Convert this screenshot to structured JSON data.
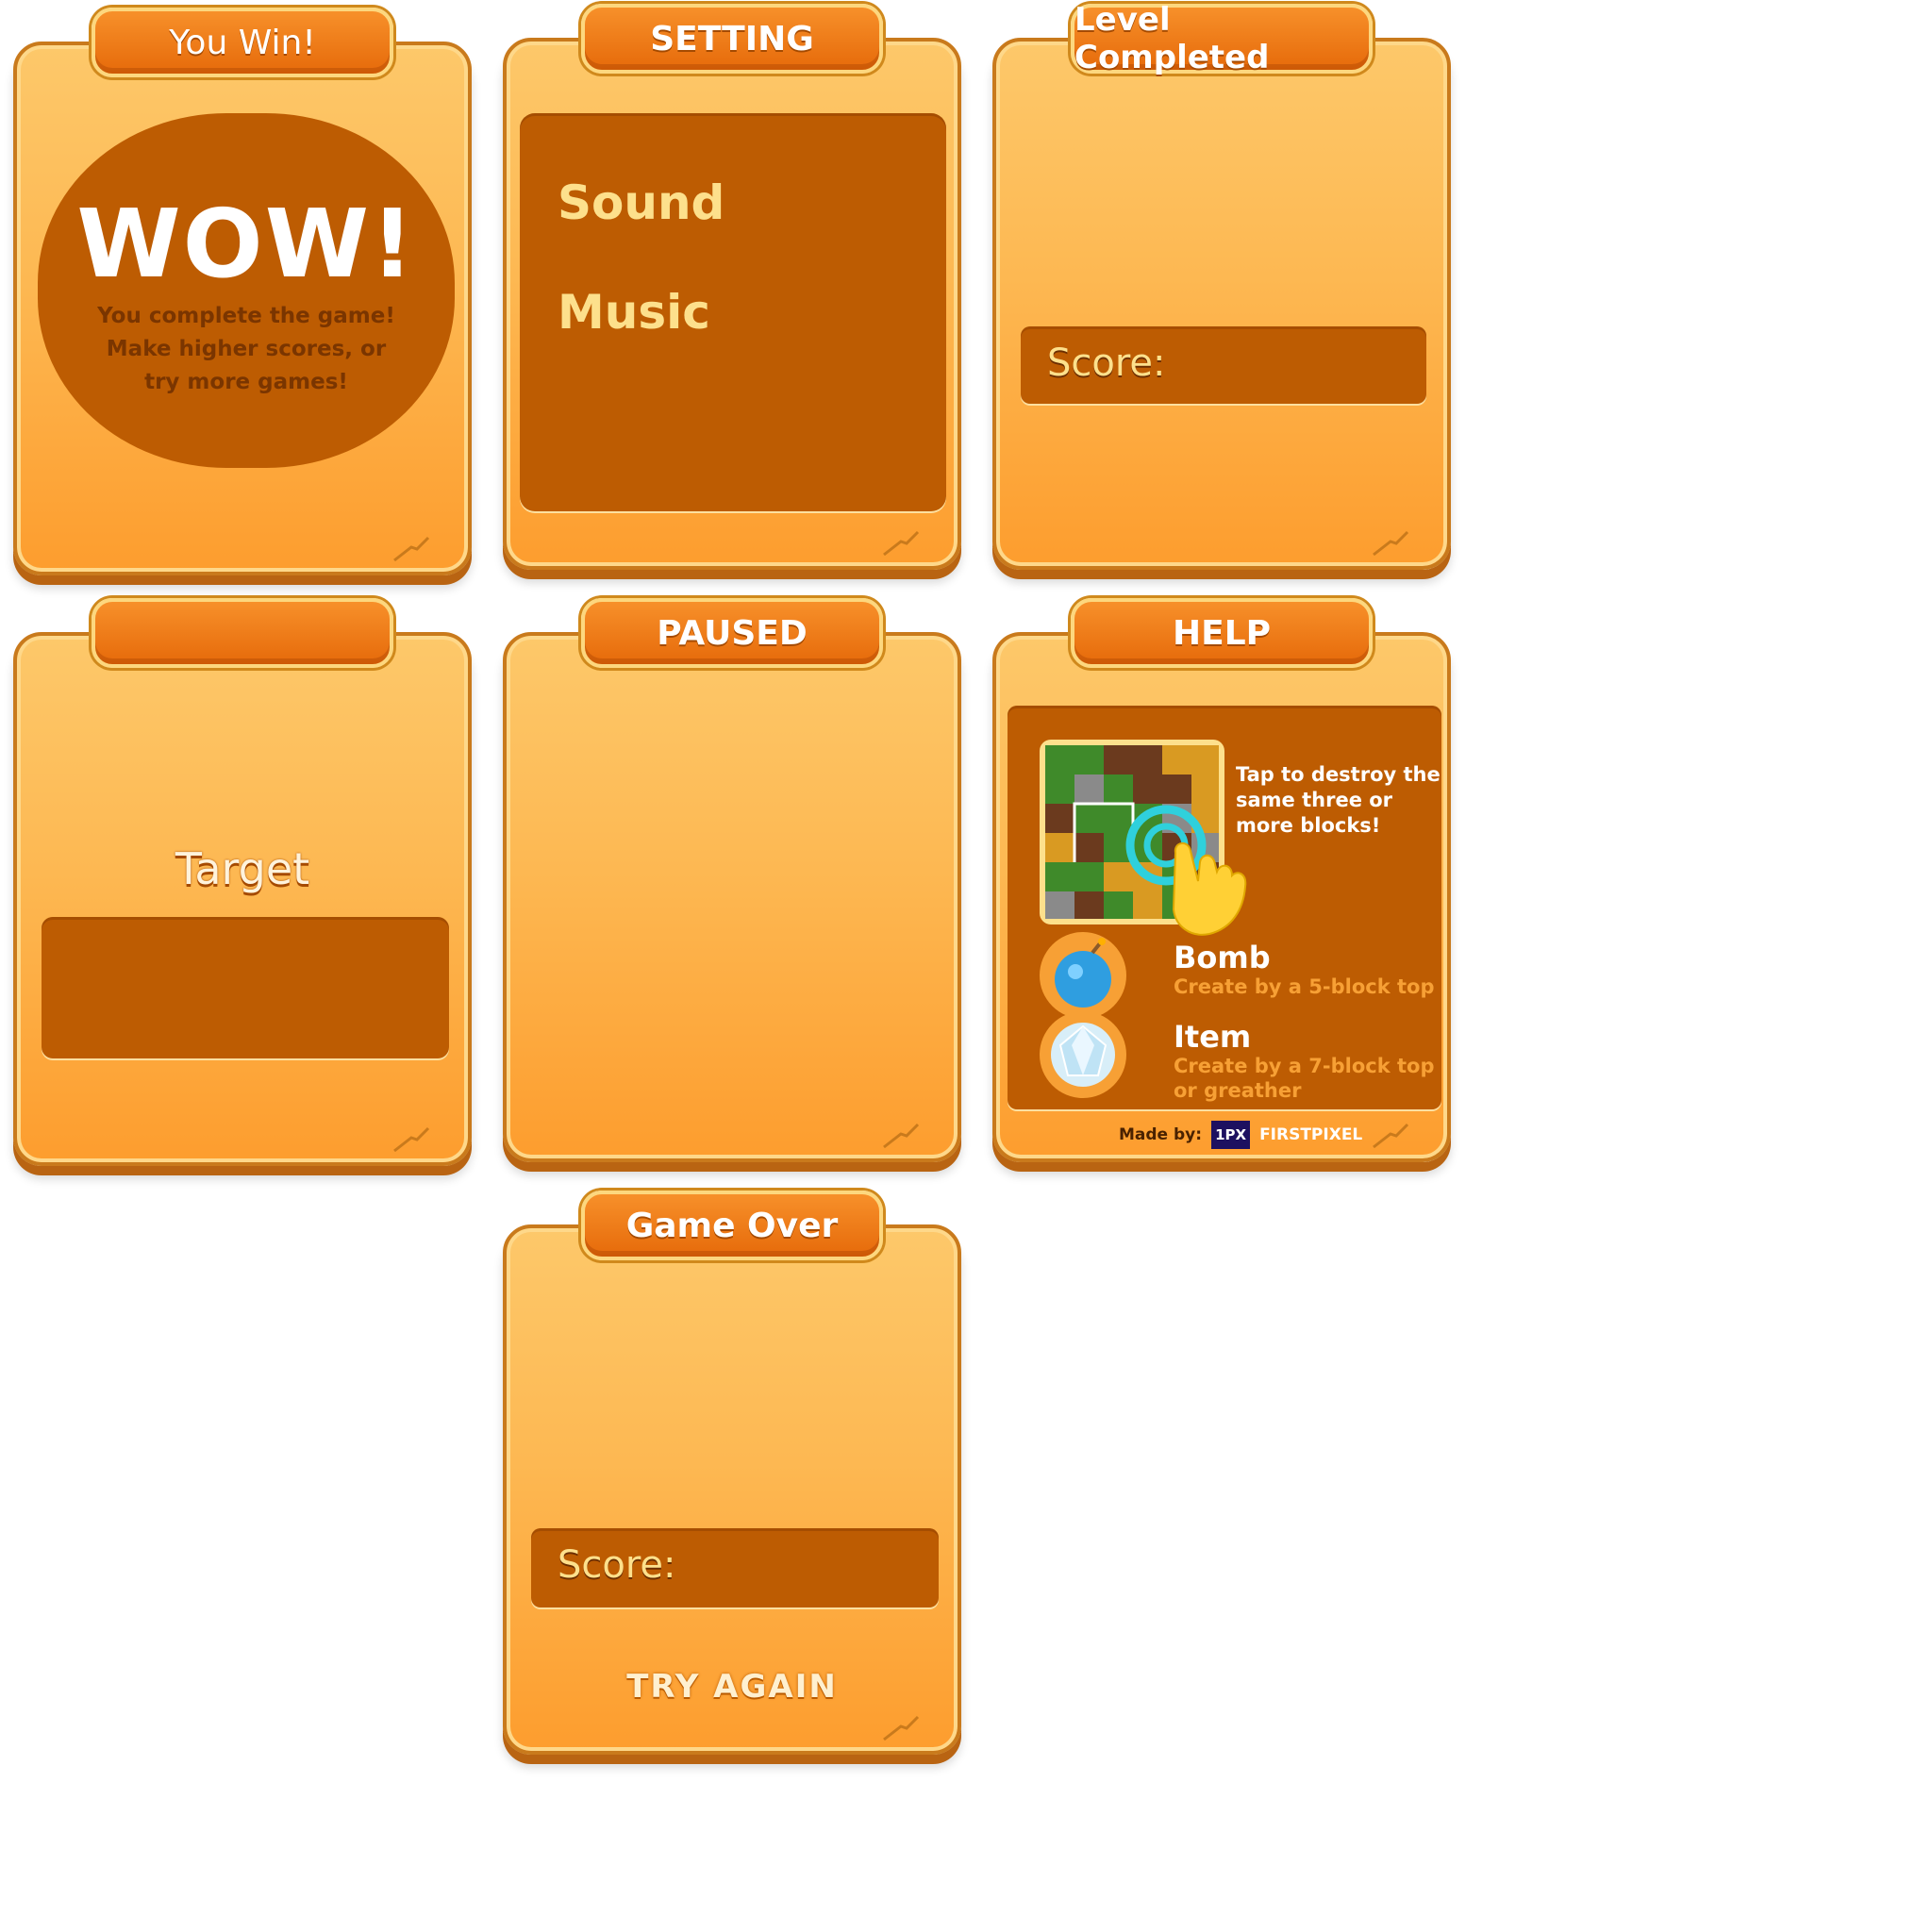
{
  "cards": {
    "you_win": {
      "title": "You Win!",
      "headline": "WOW!",
      "message_line1": "You complete the game!",
      "message_line2": "Make higher scores, or",
      "message_line3": "try more games!"
    },
    "setting": {
      "title": "SETTING",
      "sound_label": "Sound",
      "music_label": "Music"
    },
    "level_completed": {
      "title": "Level Completed",
      "score_label": "Score:"
    },
    "target": {
      "title": "",
      "target_label": "Target"
    },
    "paused": {
      "title": "PAUSED"
    },
    "help": {
      "title": "HELP",
      "tap_line1": "Tap to destroy the",
      "tap_line2": "same three or",
      "tap_line3": "more blocks!",
      "bomb_title": "Bomb",
      "bomb_desc": "Create by a 5-block top",
      "item_title": "Item",
      "item_desc_line1": "Create by a 7-block top",
      "item_desc_line2": "or greather",
      "made_by": "Made by:",
      "logo_badge": "1PX",
      "logo_text": "FIRSTPIXEL",
      "icons": [
        "block-grid-icon",
        "tap-hand-icon",
        "bomb-icon",
        "diamond-icon"
      ]
    },
    "game_over": {
      "title": "Game Over",
      "score_label": "Score:",
      "try_again_label": "TRY AGAIN"
    }
  },
  "colors": {
    "card_top": "#fdc86a",
    "card_bottom": "#fd9d2e",
    "banner": "#e66a0a",
    "panel": "#bd5c02",
    "gold_text": "#fde08c",
    "help_orange_text": "#f7a035"
  }
}
